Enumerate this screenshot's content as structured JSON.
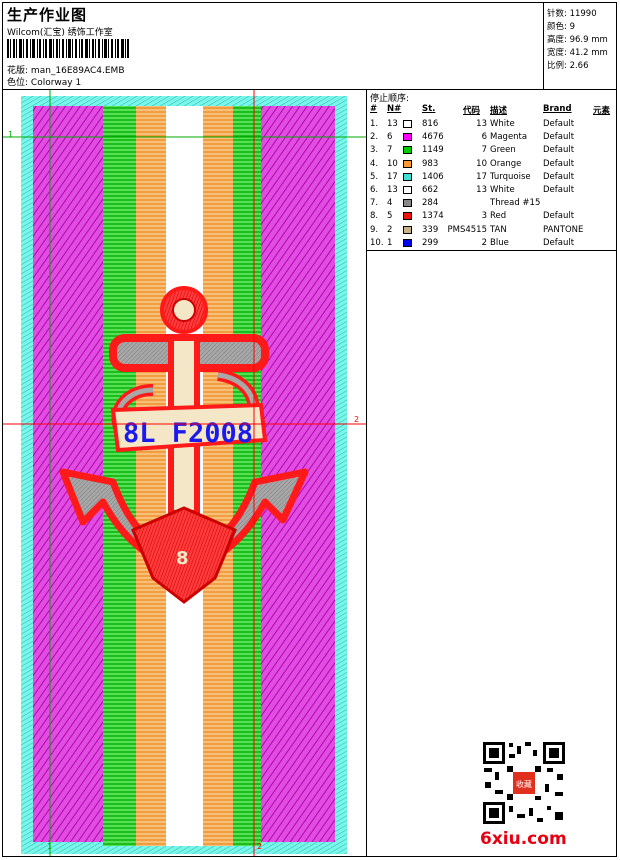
{
  "header": {
    "title": "生产作业图",
    "company": "Wilcom(汇宝) 绣饰工作室",
    "design_label": "花版:",
    "design_value": "man_16E89AC4.EMB",
    "colorway_label": "色位:",
    "colorway_value": "Colorway 1"
  },
  "stats": {
    "stitches": "针数: 11990",
    "colors": "颜色: 9",
    "height": "高度: 96.9 mm",
    "width": "宽度: 41.2 mm",
    "scale": "比例: 2.66"
  },
  "sequence": {
    "title": "停止顺序:",
    "headers": {
      "num": "#",
      "n": "N#",
      "st": "St.",
      "code": "代码",
      "desc": "描述",
      "brand": "Brand",
      "element": "元素"
    },
    "rows": [
      {
        "num": "1.",
        "n": "13",
        "color": "#ffffff",
        "st": "816",
        "code": "13",
        "desc": "White",
        "brand": "Default"
      },
      {
        "num": "2.",
        "n": "6",
        "color": "#ff00ff",
        "st": "4676",
        "code": "6",
        "desc": "Magenta",
        "brand": "Default"
      },
      {
        "num": "3.",
        "n": "7",
        "color": "#00cc00",
        "st": "1149",
        "code": "7",
        "desc": "Green",
        "brand": "Default"
      },
      {
        "num": "4.",
        "n": "10",
        "color": "#ff9933",
        "st": "983",
        "code": "10",
        "desc": "Orange",
        "brand": "Default"
      },
      {
        "num": "5.",
        "n": "17",
        "color": "#40e0d0",
        "st": "1406",
        "code": "17",
        "desc": "Turquoise",
        "brand": "Default"
      },
      {
        "num": "6.",
        "n": "13",
        "color": "#ffffff",
        "st": "662",
        "code": "13",
        "desc": "White",
        "brand": "Default"
      },
      {
        "num": "7.",
        "n": "4",
        "color": "#888888",
        "st": "284",
        "code": "",
        "desc": "Thread #15",
        "brand": ""
      },
      {
        "num": "8.",
        "n": "5",
        "color": "#ee1111",
        "st": "1374",
        "code": "3",
        "desc": "Red",
        "brand": "Default"
      },
      {
        "num": "9.",
        "n": "2",
        "color": "#c8b28a",
        "st": "339",
        "code": "PMS4515",
        "desc": "TAN",
        "brand": "PANTONE"
      },
      {
        "num": "10.",
        "n": "1",
        "color": "#0000ee",
        "st": "299",
        "code": "2",
        "desc": "Blue",
        "brand": "Default"
      }
    ]
  },
  "design": {
    "embroidery_text": "8L F2008",
    "emblem_letter": "8",
    "guide_labels": {
      "h1": "1",
      "v1": "1",
      "h2": "2",
      "v2": "2"
    }
  },
  "footer": {
    "brand": "6xiu.com",
    "qr_stamp": "收藏"
  }
}
